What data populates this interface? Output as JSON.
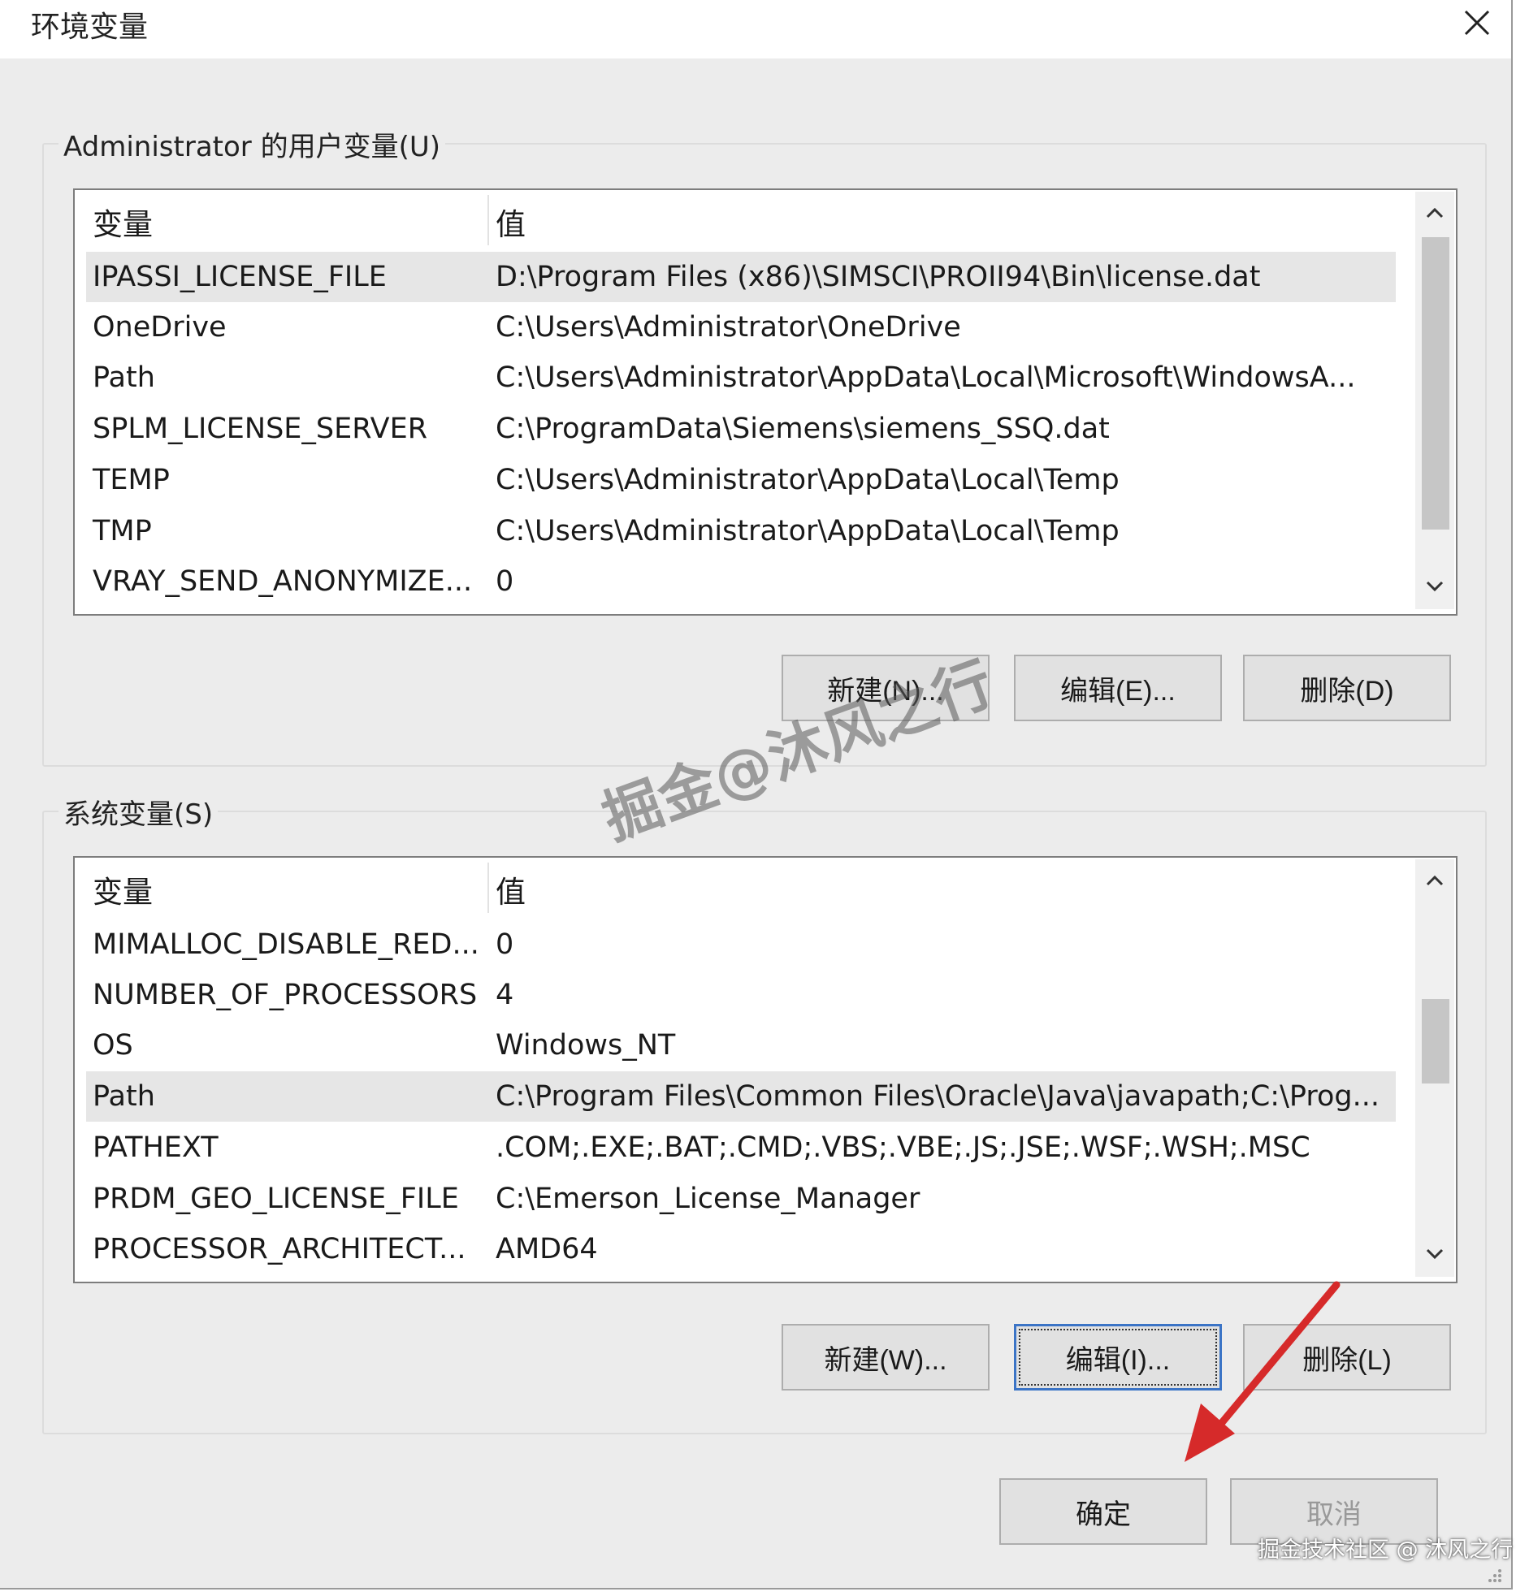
{
  "window": {
    "title": "环境变量"
  },
  "user_vars": {
    "group_label": "Administrator 的用户变量(U)",
    "columns": {
      "variable": "变量",
      "value": "值"
    },
    "rows": [
      {
        "name": "IPASSI_LICENSE_FILE",
        "value": "D:\\Program Files (x86)\\SIMSCI\\PROII94\\Bin\\license.dat",
        "selected": true
      },
      {
        "name": "OneDrive",
        "value": "C:\\Users\\Administrator\\OneDrive",
        "selected": false
      },
      {
        "name": "Path",
        "value": "C:\\Users\\Administrator\\AppData\\Local\\Microsoft\\WindowsA...",
        "selected": false
      },
      {
        "name": "SPLM_LICENSE_SERVER",
        "value": "C:\\ProgramData\\Siemens\\siemens_SSQ.dat",
        "selected": false
      },
      {
        "name": "TEMP",
        "value": "C:\\Users\\Administrator\\AppData\\Local\\Temp",
        "selected": false
      },
      {
        "name": "TMP",
        "value": "C:\\Users\\Administrator\\AppData\\Local\\Temp",
        "selected": false
      },
      {
        "name": "VRAY_SEND_ANONYMIZE...",
        "value": "0",
        "selected": false
      }
    ],
    "buttons": {
      "new": "新建(N)...",
      "edit": "编辑(E)...",
      "delete": "删除(D)"
    }
  },
  "system_vars": {
    "group_label": "系统变量(S)",
    "columns": {
      "variable": "变量",
      "value": "值"
    },
    "rows": [
      {
        "name": "MIMALLOC_DISABLE_RED...",
        "value": "0",
        "selected": false
      },
      {
        "name": "NUMBER_OF_PROCESSORS",
        "value": "4",
        "selected": false
      },
      {
        "name": "OS",
        "value": "Windows_NT",
        "selected": false
      },
      {
        "name": "Path",
        "value": "C:\\Program Files\\Common Files\\Oracle\\Java\\javapath;C:\\Prog...",
        "selected": true
      },
      {
        "name": "PATHEXT",
        "value": ".COM;.EXE;.BAT;.CMD;.VBS;.VBE;.JS;.JSE;.WSF;.WSH;.MSC",
        "selected": false
      },
      {
        "name": "PRDM_GEO_LICENSE_FILE",
        "value": "C:\\Emerson_License_Manager",
        "selected": false
      },
      {
        "name": "PROCESSOR_ARCHITECT...",
        "value": "AMD64",
        "selected": false
      }
    ],
    "buttons": {
      "new": "新建(W)...",
      "edit": "编辑(I)...",
      "delete": "删除(L)"
    }
  },
  "footer": {
    "ok": "确定",
    "cancel": "取消"
  },
  "overlay": {
    "watermark": "掘金@沐风之行",
    "credit": "掘金技术社区 @ 沐风之行",
    "arrow_color": "#d62a2a"
  },
  "icons": {
    "close": "close-icon",
    "scroll_up": "chevron-up-icon",
    "scroll_down": "chevron-down-icon"
  }
}
